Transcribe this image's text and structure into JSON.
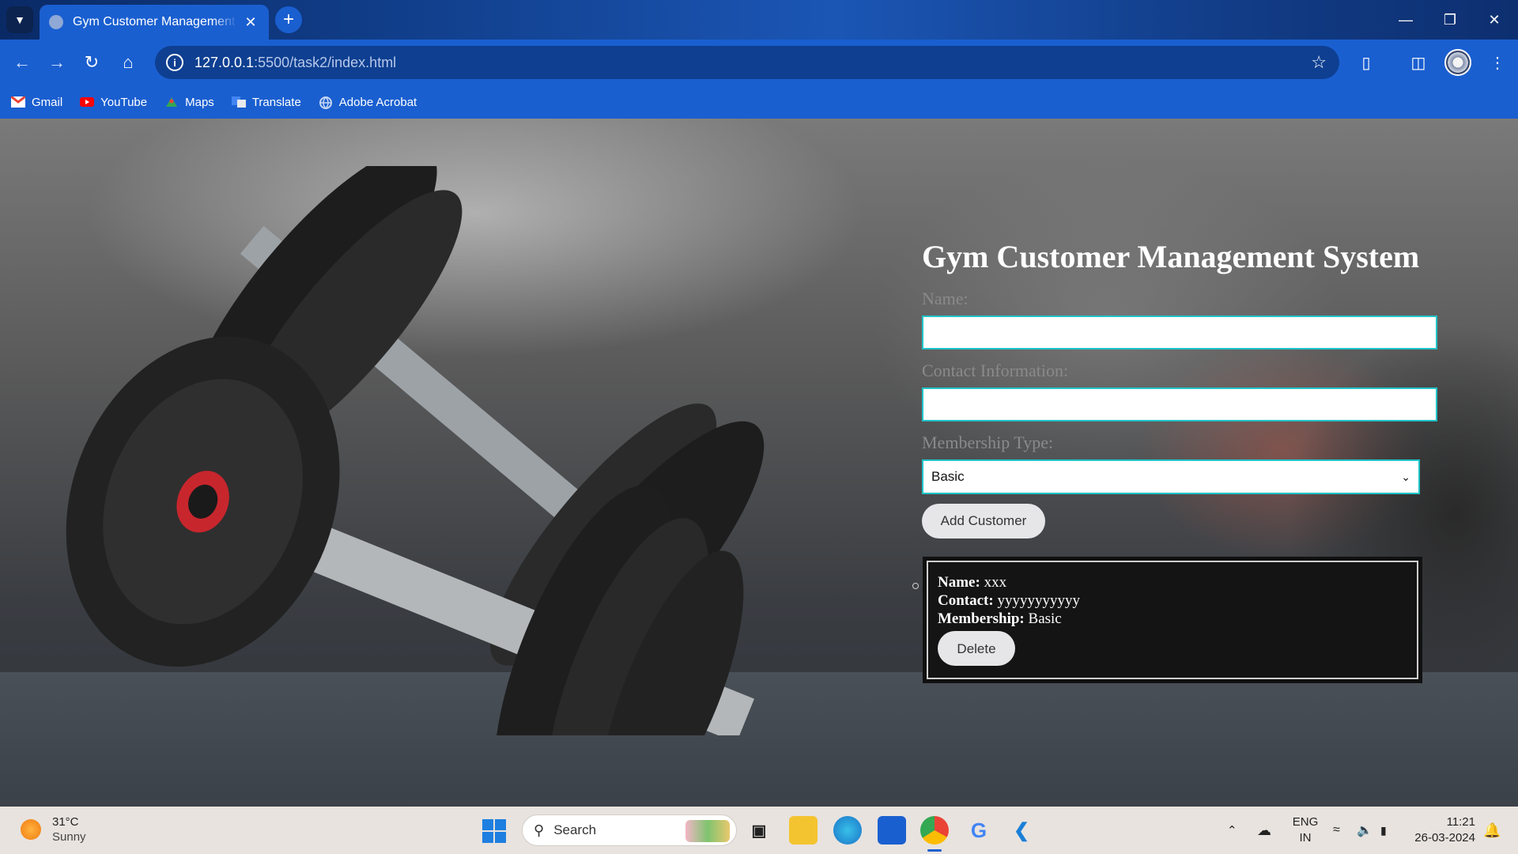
{
  "browser": {
    "tab_title": "Gym Customer Management System",
    "url_host": "127.0.0.1",
    "url_rest": ":5500/task2/index.html",
    "bookmarks": [
      {
        "label": "Gmail",
        "icon": "gmail-icon",
        "color": "#ea4335"
      },
      {
        "label": "YouTube",
        "icon": "youtube-icon",
        "color": "#ff0000"
      },
      {
        "label": "Maps",
        "icon": "maps-icon",
        "color": "#34a853"
      },
      {
        "label": "Translate",
        "icon": "translate-icon",
        "color": "#4285f4"
      },
      {
        "label": "Adobe Acrobat",
        "icon": "globe-icon",
        "color": "#c9d7f2"
      }
    ]
  },
  "app": {
    "title": "Gym Customer Management System",
    "form": {
      "name_label": "Name:",
      "name_value": "",
      "contact_label": "Contact Information:",
      "contact_value": "",
      "membership_label": "Membership Type:",
      "membership_selected": "Basic",
      "add_button": "Add Customer"
    },
    "customers": [
      {
        "name_label": "Name:",
        "name": "xxx",
        "contact_label": "Contact:",
        "contact": "yyyyyyyyyyy",
        "membership_label": "Membership:",
        "membership": "Basic",
        "delete_button": "Delete"
      }
    ]
  },
  "taskbar": {
    "temperature": "31°C",
    "weather": "Sunny",
    "search_placeholder": "Search",
    "lang_top": "ENG",
    "lang_bottom": "IN",
    "time": "11:21",
    "date": "26-03-2024"
  },
  "colors": {
    "accent_border": "#20c4c8",
    "browser_blue": "#1a5fd0"
  }
}
